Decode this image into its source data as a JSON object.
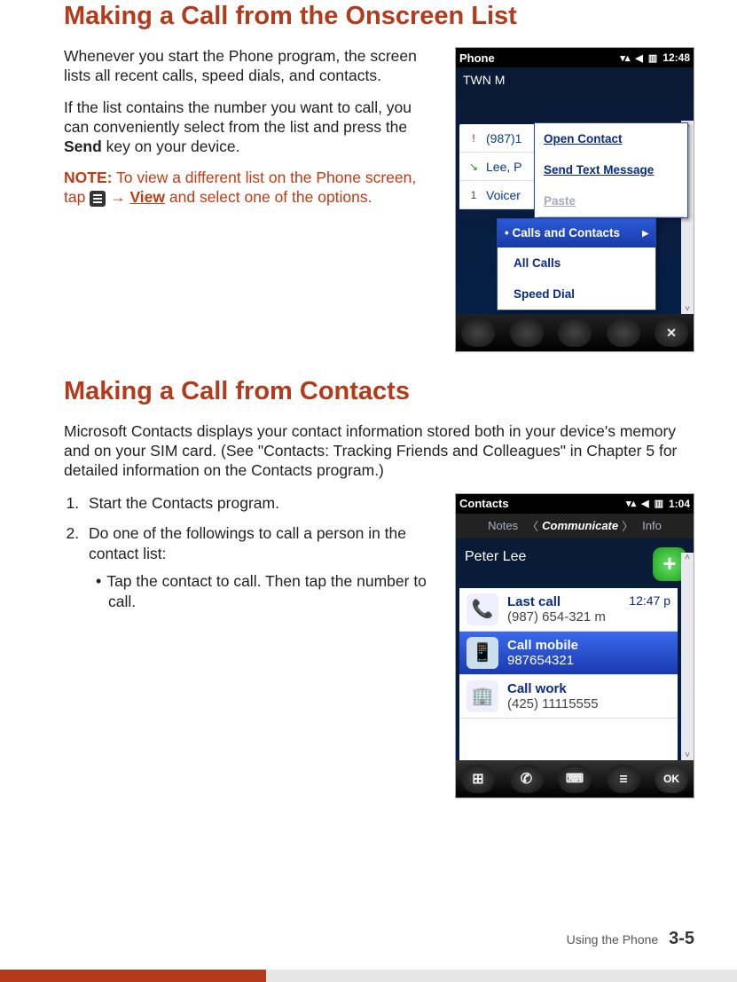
{
  "section1": {
    "heading": "Making a Call from the Onscreen List",
    "para1": "Whenever you start the Phone program, the screen lists all recent calls, speed dials, and contacts.",
    "para2_a": "If the list contains the number you want to call, you can conveniently select from the list and press the ",
    "para2_bold": "Send",
    "para2_b": " key on your device.",
    "note_label": "NOTE:",
    "note_a": " To view a different list on the Phone screen, tap ",
    "note_arrow": " → ",
    "note_view": "View",
    "note_b": " and select one of the options."
  },
  "phone1": {
    "title": "Phone",
    "time": "12:48",
    "carrier": "TWN M",
    "rows": {
      "r1_lead": "!",
      "r1_text": "(987)1",
      "r2_lead": "↘",
      "r2_text": "Lee, P",
      "r3_lead": "1",
      "r3_text": "Voicer"
    },
    "context": {
      "open": "Open Contact",
      "send": "Send Text Message",
      "paste": "Paste"
    },
    "submenu": {
      "calls_contacts": "Calls and Contacts",
      "all_calls": "All Calls",
      "speed_dial": "Speed Dial"
    }
  },
  "section2": {
    "heading": "Making a Call from Contacts",
    "intro": "Microsoft Contacts displays your contact information stored both in your device's memory and on your SIM card. (See \"Contacts: Tracking Friends and Colleagues\" in Chapter 5 for detailed information on the Contacts program.)",
    "step1": "Start the Contacts program.",
    "step2": "Do one of the followings to call a person in the contact list:",
    "bullet1": "Tap the contact to call. Then tap the number to call."
  },
  "phone2": {
    "title": "Contacts",
    "time": "1:04",
    "tabs": {
      "left": "Notes",
      "center": "Communicate",
      "right": "Info"
    },
    "name": "Peter Lee",
    "cards": {
      "last_label": "Last call",
      "last_time": "12:47 p",
      "last_num": "(987) 654-321 m",
      "mobile_label": "Call mobile",
      "mobile_num": "987654321",
      "work_label": "Call work",
      "work_num": "(425) 11115555"
    },
    "ok": "OK"
  },
  "footer": {
    "label": "Using the Phone",
    "page": "3-5"
  }
}
